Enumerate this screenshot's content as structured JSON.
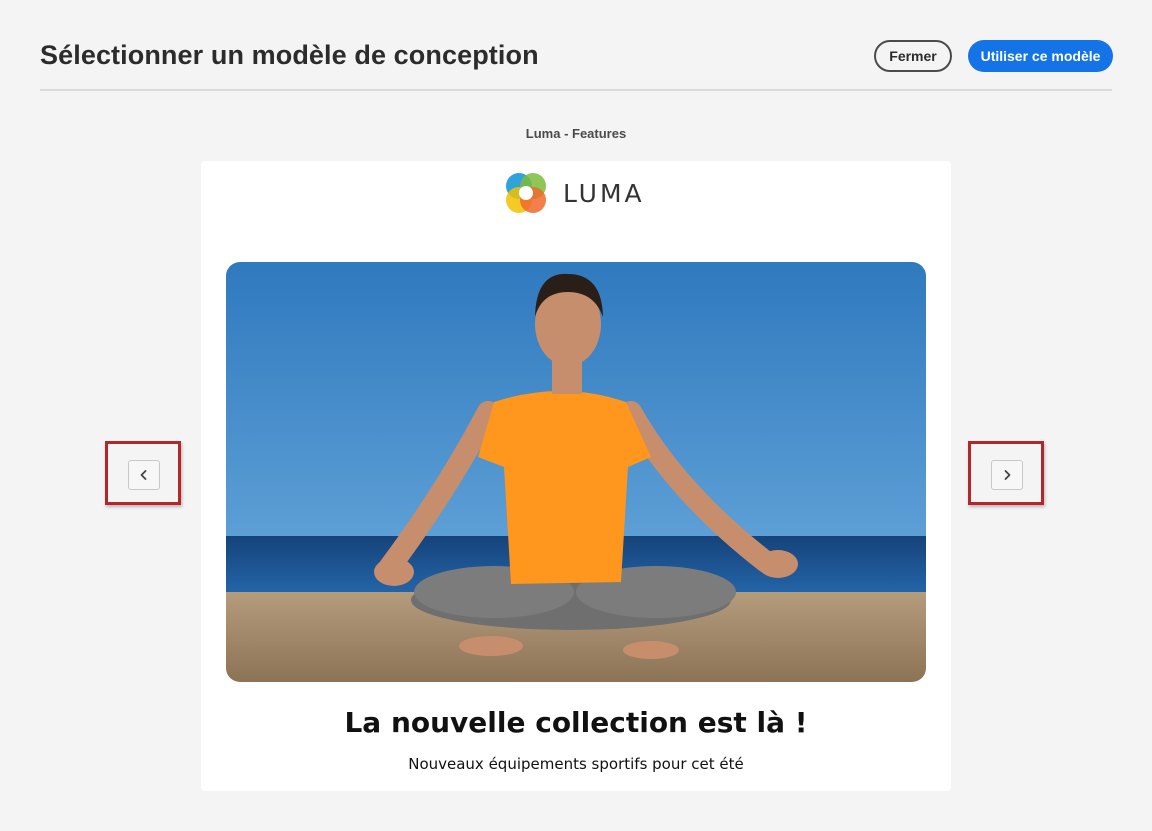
{
  "dialog": {
    "title": "Sélectionner un modèle de conception",
    "close_label": "Fermer",
    "use_label": "Utiliser ce modèle",
    "accent_color": "#1473e6"
  },
  "template": {
    "name": "Luma - Features"
  },
  "preview": {
    "logo_text": "LUMA",
    "heading": "La nouvelle collection est là !",
    "subheading": "Nouveaux équipements sportifs pour cet été"
  },
  "navigation": {
    "prev_icon": "chevron-left-icon",
    "next_icon": "chevron-right-icon",
    "highlight_color": "#b3262a"
  }
}
